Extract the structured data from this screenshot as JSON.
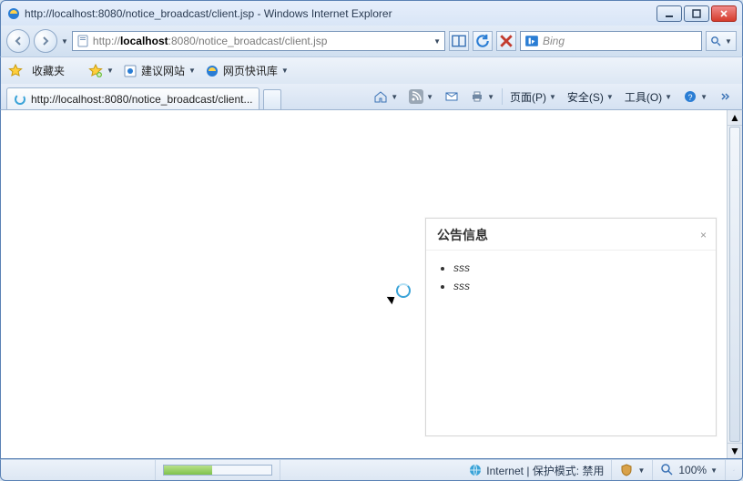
{
  "window": {
    "title_prefix": "http://localhost:8080/notice_broadcast/client.jsp",
    "title_suffix": " - Windows Internet Explorer"
  },
  "url": {
    "scheme": "http://",
    "host": "localhost",
    "port_path": ":8080/notice_broadcast/client.jsp"
  },
  "search": {
    "placeholder": "Bing"
  },
  "favbar": {
    "favorites_label": "收藏夹",
    "suggested_label": "建议网站",
    "quickfeed_label": "网页快讯库"
  },
  "tab": {
    "label": "http://localhost:8080/notice_broadcast/client..."
  },
  "cmdbar": {
    "page": "页面(P)",
    "safety": "安全(S)",
    "tools": "工具(O)"
  },
  "notice": {
    "title": "公告信息",
    "items": [
      "sss",
      "sss"
    ]
  },
  "status": {
    "zone": "Internet | 保护模式: 禁用",
    "zoom": "100%"
  }
}
